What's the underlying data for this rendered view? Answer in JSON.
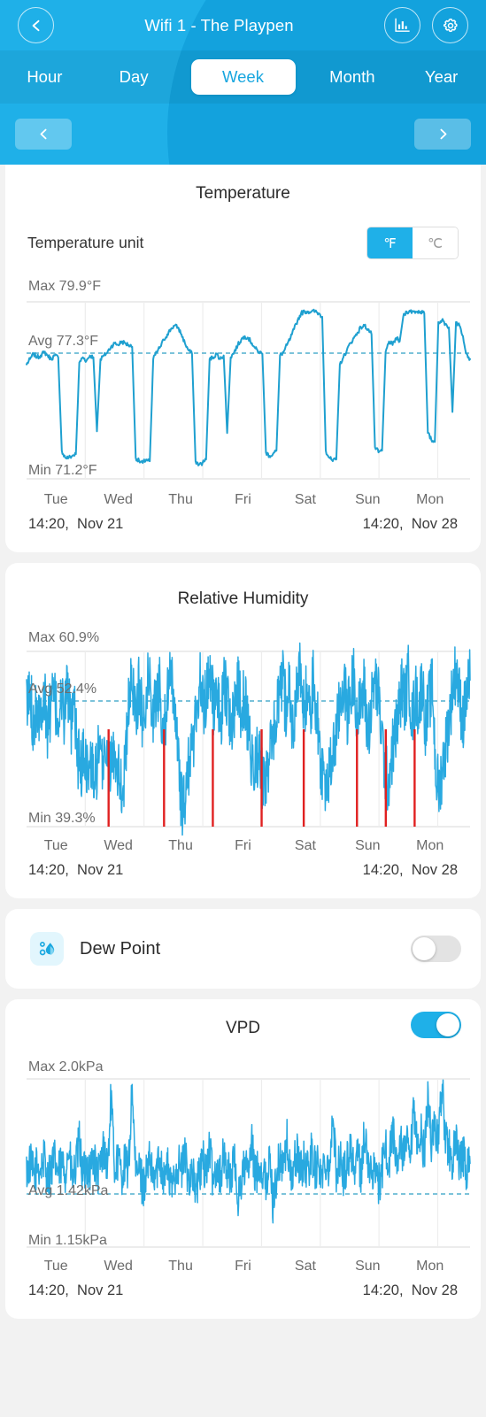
{
  "header": {
    "title": "Wifi 1 - The Playpen",
    "back_icon": "chevron-left-icon",
    "stats_icon": "bar-chart-icon",
    "settings_icon": "gear-icon",
    "periods": [
      {
        "label": "Hour",
        "active": false
      },
      {
        "label": "Day",
        "active": false
      },
      {
        "label": "Week",
        "active": true
      },
      {
        "label": "Month",
        "active": false
      },
      {
        "label": "Year",
        "active": false
      }
    ],
    "pager": {
      "prev_icon": "chevron-left-icon",
      "next_icon": "chevron-right-icon"
    },
    "accent": "#1fb0e8",
    "background": "#1aa8e0"
  },
  "temperature": {
    "title": "Temperature",
    "unit_label": "Temperature unit",
    "unit_options": [
      {
        "label": "℉",
        "selected": true
      },
      {
        "label": "℃",
        "selected": false
      }
    ],
    "max_label": "Max 79.9°F",
    "avg_label": "Avg 77.3°F",
    "min_label": "Min 71.2°F",
    "days": [
      "Tue",
      "Wed",
      "Thu",
      "Fri",
      "Sat",
      "Sun",
      "Mon"
    ],
    "range_start": "14:20,  Nov 21",
    "range_end": "14:20,  Nov 28",
    "line_color": "#1fa0d0"
  },
  "humidity": {
    "title": "Relative Humidity",
    "max_label": "Max 60.9%",
    "avg_label": "Avg 52.4%",
    "min_label": "Min 39.3%",
    "days": [
      "Tue",
      "Wed",
      "Thu",
      "Fri",
      "Sat",
      "Sun",
      "Mon"
    ],
    "range_start": "14:20,  Nov 21",
    "range_end": "14:20,  Nov 28",
    "line_color": "#29a9e0",
    "alert_color": "#e02020"
  },
  "dew_point": {
    "label": "Dew Point",
    "icon": "dew-drop-icon",
    "enabled": false
  },
  "vpd": {
    "title": "VPD",
    "enabled": true,
    "max_label": "Max 2.0kPa",
    "avg_label": "Avg 1.42kPa",
    "min_label": "Min 1.15kPa",
    "days": [
      "Tue",
      "Wed",
      "Thu",
      "Fri",
      "Sat",
      "Sun",
      "Mon"
    ],
    "range_start": "14:20,  Nov 21",
    "range_end": "14:20,  Nov 28",
    "line_color": "#29a9e0"
  },
  "chart_data": [
    {
      "type": "line",
      "title": "Temperature",
      "ylabel": "°F",
      "xlabel": "",
      "ylim": [
        71.2,
        79.9
      ],
      "max": 79.9,
      "avg": 77.3,
      "min": 71.2,
      "categories": [
        "Tue",
        "Wed",
        "Thu",
        "Fri",
        "Sat",
        "Sun",
        "Mon"
      ],
      "x_range": [
        "14:20, Nov 21",
        "14:20, Nov 28"
      ],
      "grid": true,
      "legend": "none",
      "series": [
        {
          "name": "Temperature (°F)",
          "values": [
            76.9,
            77.2,
            77.5,
            77.3,
            77.4,
            77.6,
            77.4,
            77.2,
            77.4,
            77.3,
            72.0,
            71.6,
            71.6,
            71.7,
            71.8,
            77.0,
            77.3,
            77.1,
            77.4,
            77.3,
            73.1,
            77.2,
            77.4,
            77.6,
            77.9,
            78.1,
            78.0,
            78.2,
            78.1,
            78.0,
            77.9,
            71.6,
            71.4,
            71.3,
            71.5,
            71.4,
            77.2,
            77.6,
            77.9,
            78.3,
            78.6,
            78.9,
            79.1,
            79.0,
            78.6,
            78.1,
            77.7,
            77.5,
            71.4,
            71.2,
            71.3,
            71.5,
            77.2,
            77.3,
            77.5,
            77.2,
            77.4,
            73.0,
            77.3,
            77.6,
            78.0,
            78.3,
            78.5,
            78.4,
            78.1,
            77.8,
            77.6,
            77.5,
            71.9,
            71.7,
            71.8,
            72.0,
            77.4,
            77.6,
            78.0,
            78.4,
            78.9,
            79.4,
            79.8,
            79.9,
            79.9,
            79.9,
            79.9,
            79.8,
            79.6,
            72.0,
            71.6,
            71.4,
            71.5,
            76.9,
            77.3,
            77.7,
            78.1,
            78.4,
            78.7,
            79.0,
            79.1,
            78.9,
            78.6,
            72.2,
            71.9,
            72.0,
            77.6,
            78.2,
            78.0,
            78.4,
            78.2,
            79.6,
            79.9,
            79.9,
            79.9,
            79.9,
            79.9,
            79.8,
            73.0,
            72.6,
            72.5,
            79.3,
            79.4,
            79.2,
            79.0,
            74.2,
            79.3,
            79.1,
            78.5,
            77.5,
            77.2
          ]
        }
      ]
    },
    {
      "type": "line",
      "title": "Relative Humidity",
      "ylabel": "%",
      "xlabel": "",
      "ylim": [
        39.3,
        60.9
      ],
      "max": 60.9,
      "avg": 52.4,
      "min": 39.3,
      "categories": [
        "Tue",
        "Wed",
        "Thu",
        "Fri",
        "Sat",
        "Sun",
        "Mon"
      ],
      "x_range": [
        "14:20, Nov 21",
        "14:20, Nov 28"
      ],
      "grid": true,
      "legend": "none",
      "note": "high-frequency oscillating signal with red low-spike markers",
      "alert_spikes_x": [
        0.185,
        0.31,
        0.42,
        0.53,
        0.625,
        0.745,
        0.81,
        0.875
      ],
      "series": [
        {
          "name": "Relative Humidity (%)",
          "values": [
            54,
            56,
            52,
            55,
            53,
            57,
            51,
            54,
            56,
            52,
            55,
            53,
            58,
            50,
            54,
            47,
            45,
            48,
            44,
            46,
            43,
            47,
            45,
            49,
            44,
            46,
            48,
            45,
            42,
            46,
            55,
            58,
            54,
            57,
            52,
            56,
            59,
            53,
            55,
            57,
            51,
            54,
            58,
            56,
            52,
            41,
            39,
            44,
            47,
            50,
            55,
            58,
            54,
            57,
            60,
            53,
            56,
            52,
            58,
            55,
            51,
            54,
            57,
            53,
            56,
            50,
            47,
            45,
            48,
            44,
            43,
            46,
            49,
            52,
            55,
            58,
            54,
            57,
            51,
            55,
            60,
            53,
            56,
            52,
            58,
            54,
            47,
            44,
            42,
            45,
            48,
            51,
            55,
            58,
            53,
            56,
            59,
            52,
            55,
            57,
            50,
            54,
            58,
            56,
            51,
            45,
            43,
            47,
            50,
            53,
            57,
            55,
            59,
            52,
            56,
            54,
            58,
            51,
            55,
            57,
            44,
            42,
            46,
            49,
            53,
            57,
            60,
            55,
            52,
            56,
            58
          ]
        }
      ]
    },
    {
      "type": "line",
      "title": "VPD",
      "ylabel": "kPa",
      "xlabel": "",
      "ylim": [
        1.15,
        2.0
      ],
      "max": 2.0,
      "avg": 1.42,
      "min": 1.15,
      "categories": [
        "Tue",
        "Wed",
        "Thu",
        "Fri",
        "Sat",
        "Sun",
        "Mon"
      ],
      "x_range": [
        "14:20, Nov 21",
        "14:20, Nov 28"
      ],
      "grid": true,
      "legend": "none",
      "series": [
        {
          "name": "VPD (kPa)",
          "values": [
            1.4,
            1.46,
            1.38,
            1.44,
            1.42,
            1.5,
            1.36,
            1.43,
            1.48,
            1.39,
            1.45,
            1.41,
            1.55,
            1.34,
            1.43,
            1.62,
            1.35,
            1.47,
            1.4,
            1.52,
            1.37,
            1.44,
            1.58,
            1.41,
            1.9,
            1.43,
            1.49,
            1.38,
            1.46,
            1.42,
            2.0,
            1.35,
            1.44,
            1.3,
            1.39,
            1.47,
            1.33,
            1.42,
            1.5,
            1.36,
            1.45,
            1.28,
            1.38,
            1.47,
            1.41,
            1.52,
            1.35,
            1.44,
            1.25,
            1.37,
            1.48,
            1.42,
            1.56,
            1.34,
            1.45,
            1.39,
            1.5,
            1.43,
            1.36,
            1.48,
            1.22,
            1.35,
            1.44,
            1.4,
            1.58,
            1.37,
            1.46,
            1.41,
            1.33,
            1.47,
            1.2,
            1.38,
            1.49,
            1.43,
            1.61,
            1.36,
            1.45,
            1.52,
            1.4,
            1.48,
            1.39,
            1.55,
            1.42,
            1.47,
            1.36,
            1.5,
            1.44,
            1.75,
            1.41,
            1.49,
            1.38,
            1.46,
            1.58,
            1.43,
            1.52,
            1.4,
            1.66,
            1.45,
            1.37,
            1.48,
            1.3,
            1.42,
            1.56,
            1.47,
            1.7,
            1.44,
            1.62,
            1.5,
            1.58,
            1.46,
            1.8,
            1.55,
            1.68,
            1.52,
            1.9,
            1.6,
            1.75,
            1.58,
            2.0,
            1.65,
            1.55,
            1.48,
            1.6,
            1.44,
            1.52,
            1.41,
            1.46
          ]
        }
      ]
    }
  ]
}
